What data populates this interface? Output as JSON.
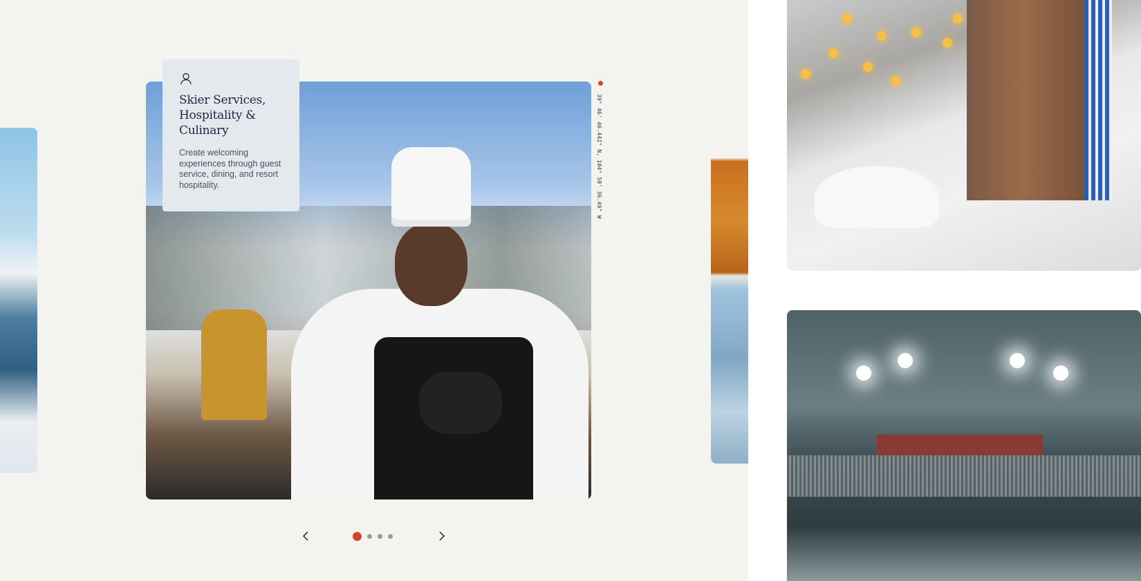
{
  "card": {
    "icon": "user-icon",
    "title": "Skier Services, Hospitality & Culinary",
    "description": "Create welcoming experiences through guest service, dining, and resort hospitality."
  },
  "coordinates": "39° 46' 46.442\" N, 104° 58' 36.49\" W",
  "carousel": {
    "prev_icon": "chevron-left-icon",
    "next_icon": "chevron-right-icon",
    "active_index": 0,
    "total": 4
  },
  "colors": {
    "accent": "#d0442a",
    "panel_bg": "#f3f3ef",
    "card_bg": "#e4e9ee",
    "title_color": "#1e2440"
  },
  "photos": {
    "main": "chef-photo",
    "left_peek": "mountain-photo",
    "right_peek": "trail-map-photo",
    "top_right": "snowy-street-photo",
    "bottom_right": "snow-groomer-photo"
  }
}
